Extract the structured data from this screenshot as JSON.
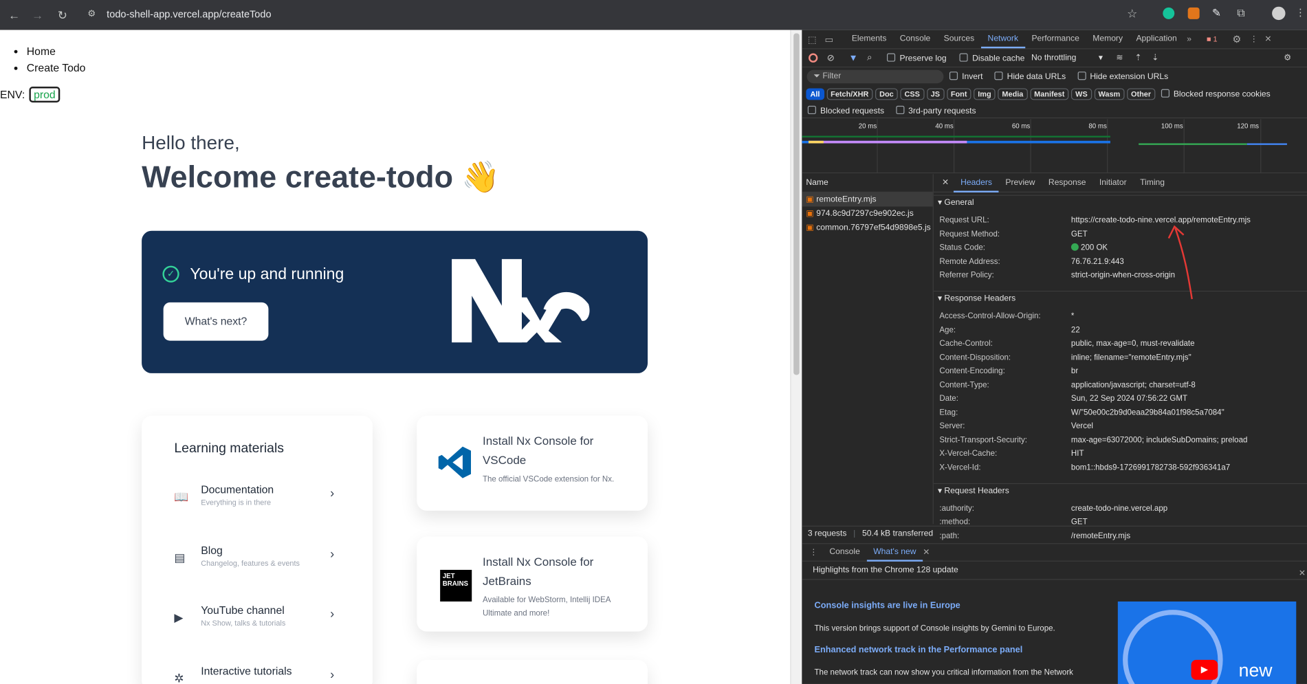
{
  "browser": {
    "url": "todo-shell-app.vercel.app/createTodo"
  },
  "nav": {
    "items": [
      "Home",
      "Create Todo"
    ]
  },
  "env": {
    "label": "ENV:",
    "value": "prod"
  },
  "hero": {
    "greeting": "Hello there,",
    "title": "Welcome create-todo 👋",
    "status": "You're up and running",
    "button": "What's next?",
    "logo_text": "N"
  },
  "learning": {
    "title": "Learning materials",
    "items": [
      {
        "title": "Documentation",
        "subtitle": "Everything is in there",
        "icon": "book-icon"
      },
      {
        "title": "Blog",
        "subtitle": "Changelog, features & events",
        "icon": "blog-icon"
      },
      {
        "title": "YouTube channel",
        "subtitle": "Nx Show, talks & tutorials",
        "icon": "youtube-icon"
      },
      {
        "title": "Interactive tutorials",
        "subtitle": "",
        "icon": "cursor-icon"
      }
    ]
  },
  "consoles": [
    {
      "title": "Install Nx Console for VSCode",
      "subtitle": "The official VSCode extension for Nx.",
      "icon": "vscode-icon"
    },
    {
      "title": "Install Nx Console for JetBrains",
      "subtitle": "Available for WebStorm, Intellij IDEA Ultimate and more!",
      "icon": "jetbrains-icon",
      "badge": "JET BRAINS"
    }
  ],
  "devtools": {
    "tabs": [
      "Elements",
      "Console",
      "Sources",
      "Network",
      "Performance",
      "Memory",
      "Application"
    ],
    "active_tab": "Network",
    "issues_count": "1",
    "toolbar": {
      "preserve_log": "Preserve log",
      "disable_cache": "Disable cache",
      "throttling": "No throttling"
    },
    "filter": {
      "placeholder": "Filter",
      "invert": "Invert",
      "hide_data": "Hide data URLs",
      "hide_ext": "Hide extension URLs"
    },
    "types": [
      "All",
      "Fetch/XHR",
      "Doc",
      "CSS",
      "JS",
      "Font",
      "Img",
      "Media",
      "Manifest",
      "WS",
      "Wasm",
      "Other"
    ],
    "blocked_cookies": "Blocked response cookies",
    "blocked_requests": "Blocked requests",
    "third_party": "3rd-party requests",
    "timeline_ticks": [
      "20 ms",
      "40 ms",
      "60 ms",
      "80 ms",
      "100 ms",
      "120 ms"
    ],
    "name_header": "Name",
    "requests": [
      "remoteEntry.mjs",
      "974.8c9d7297c9e902ec.js",
      "common.76797ef54d9898e5.js"
    ],
    "detail_tabs": [
      "Headers",
      "Preview",
      "Response",
      "Initiator",
      "Timing"
    ],
    "general_title": "General",
    "general": [
      {
        "k": "Request URL:",
        "v": "https://create-todo-nine.vercel.app/remoteEntry.mjs"
      },
      {
        "k": "Request Method:",
        "v": "GET"
      },
      {
        "k": "Status Code:",
        "v": "200 OK"
      },
      {
        "k": "Remote Address:",
        "v": "76.76.21.9:443"
      },
      {
        "k": "Referrer Policy:",
        "v": "strict-origin-when-cross-origin"
      }
    ],
    "response_title": "Response Headers",
    "response": [
      {
        "k": "Access-Control-Allow-Origin:",
        "v": "*"
      },
      {
        "k": "Age:",
        "v": "22"
      },
      {
        "k": "Cache-Control:",
        "v": "public, max-age=0, must-revalidate"
      },
      {
        "k": "Content-Disposition:",
        "v": "inline; filename=\"remoteEntry.mjs\""
      },
      {
        "k": "Content-Encoding:",
        "v": "br"
      },
      {
        "k": "Content-Type:",
        "v": "application/javascript; charset=utf-8"
      },
      {
        "k": "Date:",
        "v": "Sun, 22 Sep 2024 07:56:22 GMT"
      },
      {
        "k": "Etag:",
        "v": "W/\"50e00c2b9d0eaa29b84a01f98c5a7084\""
      },
      {
        "k": "Server:",
        "v": "Vercel"
      },
      {
        "k": "Strict-Transport-Security:",
        "v": "max-age=63072000; includeSubDomains; preload"
      },
      {
        "k": "X-Vercel-Cache:",
        "v": "HIT"
      },
      {
        "k": "X-Vercel-Id:",
        "v": "bom1::hbds9-1726991782738-592f936341a7"
      }
    ],
    "request_title": "Request Headers",
    "request": [
      {
        "k": ":authority:",
        "v": "create-todo-nine.vercel.app"
      },
      {
        "k": ":method:",
        "v": "GET"
      },
      {
        "k": ":path:",
        "v": "/remoteEntry.mjs"
      }
    ],
    "summary": {
      "requests": "3 requests",
      "transferred": "50.4 kB transferred"
    },
    "drawer": {
      "tabs": [
        "Console",
        "What's new"
      ],
      "highlight": "Highlights from the Chrome 128 update",
      "items": [
        {
          "title": "Console insights are live in Europe",
          "desc": "This version brings support of Console insights by Gemini to Europe."
        },
        {
          "title": "Enhanced network track in the Performance panel",
          "desc": "The network track can now show you critical information from the Network"
        }
      ],
      "video_label": "new"
    }
  }
}
